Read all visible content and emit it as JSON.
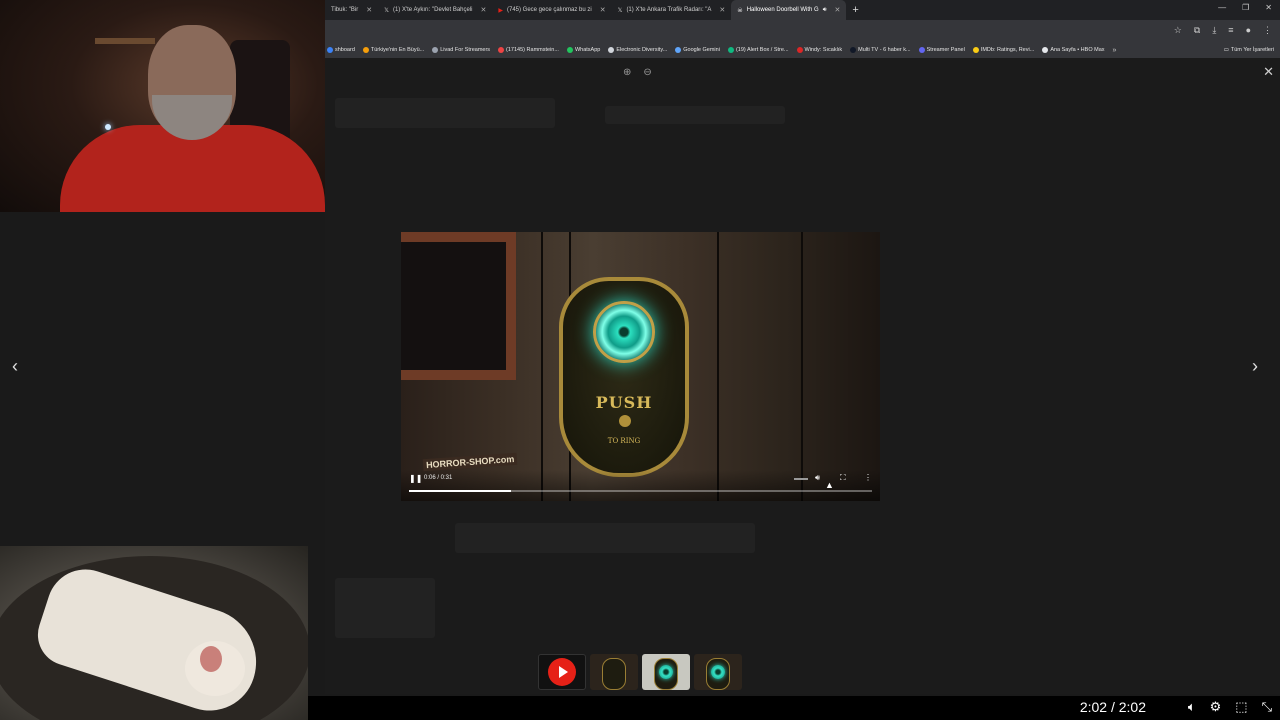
{
  "tabs": [
    {
      "label": "Tibuk: \"Bir",
      "active": false
    },
    {
      "label": "(1) X'te Aykırı: \"Devlet Bahçeli",
      "active": false
    },
    {
      "label": "(745) Gece gece çalınmaz bu zi",
      "active": false
    },
    {
      "label": "(1) X'te Ankara Trafik Radarı: \"A",
      "active": false
    },
    {
      "label": "Halloween Doorbell With G",
      "active": true
    }
  ],
  "bookmarks": [
    {
      "label": "shboard",
      "color": "#3b82f6"
    },
    {
      "label": "Türkiye'nin En Büyü...",
      "color": "#f59e0b"
    },
    {
      "label": "Livad For Streamers",
      "color": "#9ca3af"
    },
    {
      "label": "(17145) Rammstein...",
      "color": "#ef4444"
    },
    {
      "label": "WhatsApp",
      "color": "#22c55e"
    },
    {
      "label": "Electronic Diversity...",
      "color": "#d1d5db"
    },
    {
      "label": "Google Gemini",
      "color": "#60a5fa"
    },
    {
      "label": "(19) Alert Box / Stre...",
      "color": "#10b981"
    },
    {
      "label": "Windy: Sıcaklık",
      "color": "#dc2626"
    },
    {
      "label": "Multi TV - 6 haber k...",
      "color": "#111827"
    },
    {
      "label": "Streamer Panel",
      "color": "#6366f1"
    },
    {
      "label": "IMDb: Ratings, Revi...",
      "color": "#facc15"
    },
    {
      "label": "Ana Sayfa • HBO Max",
      "color": "#e5e7eb"
    }
  ],
  "bookmarks_more": "»",
  "bookmarks_folder": "Tüm Yer İşaretleri",
  "video": {
    "time": "0:06 / 0:31",
    "progress": 0.22,
    "sign_main": "PUSH",
    "sign_sub": "TO RING",
    "watermark": "HORROR-SHOP.com"
  },
  "player": {
    "time": "2:02 / 2:02"
  },
  "icons": {
    "zoom_in": "zoom-in-icon",
    "zoom_out": "zoom-out-icon",
    "close": "close-icon",
    "prev": "chevron-left-icon",
    "next": "chevron-right-icon"
  },
  "colors": {
    "youtube_red": "#e62117",
    "eye_glow": "#2dd4bf",
    "brass": "#a88a3a"
  }
}
